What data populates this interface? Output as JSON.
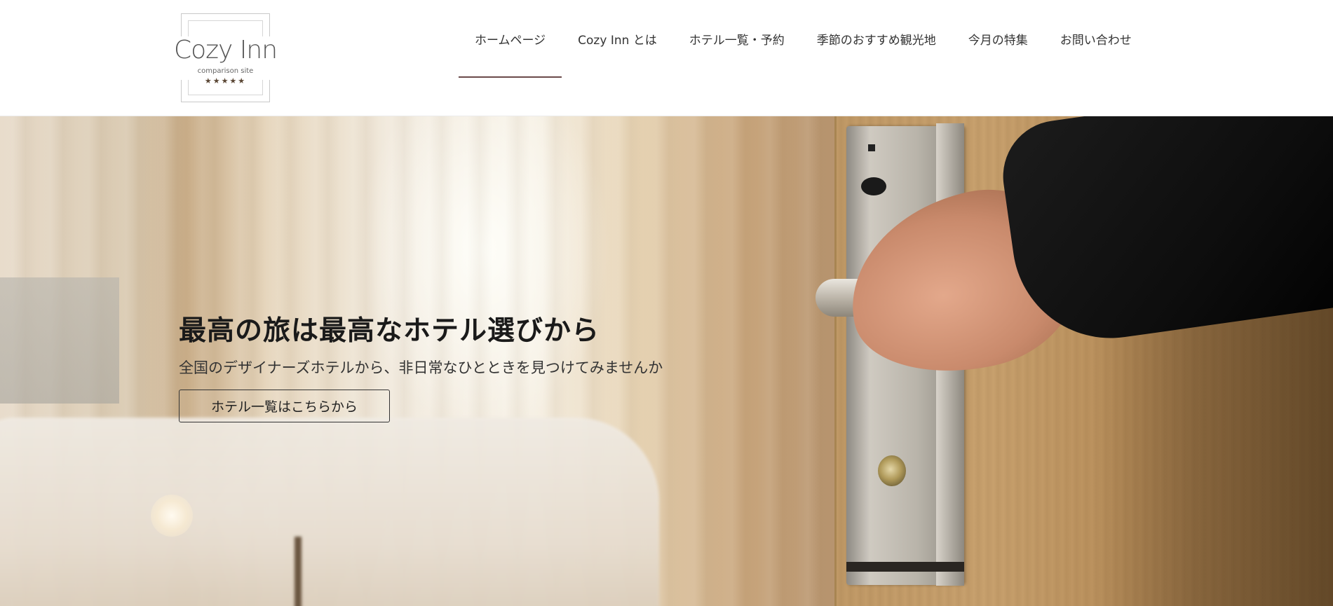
{
  "header": {
    "logo": {
      "name": "Cozy Inn",
      "tagline": "comparison site",
      "stars": "★★★★★"
    },
    "nav": [
      {
        "label": "ホームページ",
        "active": true
      },
      {
        "label": "Cozy Inn とは",
        "active": false
      },
      {
        "label": "ホテル一覧・予約",
        "active": false
      },
      {
        "label": "季節のおすすめ観光地",
        "active": false
      },
      {
        "label": "今月の特集",
        "active": false
      },
      {
        "label": "お問い合わせ",
        "active": false
      }
    ]
  },
  "hero": {
    "title": "最高の旅は最高なホテル選びから",
    "subtitle": "全国のデザイナーズホテルから、非日常なひとときを見つけてみませんか",
    "cta_label": "ホテル一覧はこちらから"
  },
  "colors": {
    "nav_active_underline": "#6a4a4a",
    "text_dark": "#1a1a1a"
  }
}
